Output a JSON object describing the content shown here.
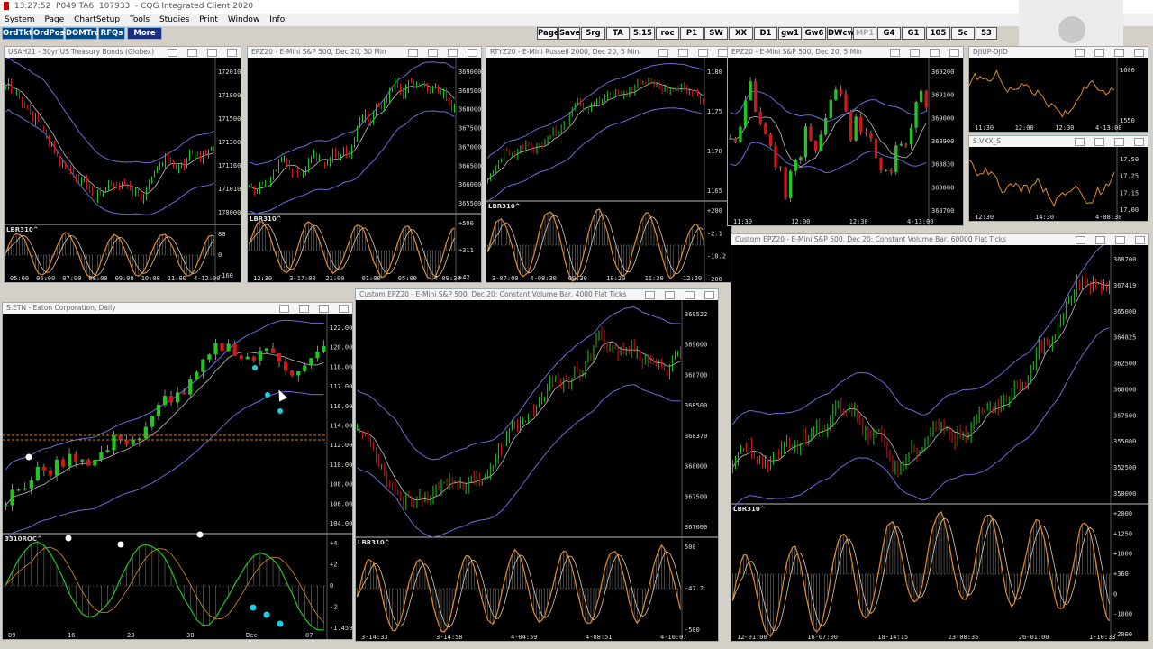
{
  "titlebar": {
    "time": "13:27:52",
    "code1": "P049 TA6",
    "code2": "107933",
    "app": "CQG Integrated Client 2020"
  },
  "menu": [
    "System",
    "Page",
    "ChartSetup",
    "Tools",
    "Studies",
    "Print",
    "Window",
    "Info"
  ],
  "trade_buttons": [
    "OrdTkt",
    "OrdPos",
    "DOMTrd",
    "RFQs",
    "More"
  ],
  "quick_buttons": [
    {
      "label": "Page",
      "dim": false
    },
    {
      "label": "Save",
      "dim": false
    },
    {
      "label": "5rg",
      "dim": false
    },
    {
      "label": "TA",
      "dim": false
    },
    {
      "label": "5.15",
      "dim": false
    },
    {
      "label": "roc",
      "dim": false
    },
    {
      "label": "P1",
      "dim": false
    },
    {
      "label": "SW",
      "dim": false
    },
    {
      "label": "XX",
      "dim": false
    },
    {
      "label": "D1",
      "dim": false
    },
    {
      "label": "gw1",
      "dim": false
    },
    {
      "label": "Gw6",
      "dim": false
    },
    {
      "label": "DWcw",
      "dim": false
    },
    {
      "label": "MP1",
      "dim": true
    },
    {
      "label": "G4",
      "dim": false
    },
    {
      "label": "G1",
      "dim": false
    },
    {
      "label": "105",
      "dim": false
    },
    {
      "label": "5c",
      "dim": false
    },
    {
      "label": "53",
      "dim": false
    }
  ],
  "colors": {
    "up": "#22c522",
    "down": "#d11818",
    "band": "#6b6bd8",
    "ma": "#bfbfbf",
    "osc": "#e08a2a",
    "cyan": "#15d0e8"
  },
  "windows": [
    {
      "id": "usa",
      "title": "USAH21 - 30yr US Treasury Bonds (Globex)",
      "indicator": "LBR310^",
      "price_labels": [
        "172010",
        "171800",
        "171500",
        "171300",
        "171160",
        "171010",
        "170000"
      ],
      "osc_labels": [
        "80",
        "0",
        "-160"
      ],
      "time_labels": [
        "05:00",
        "06:00",
        "07:00",
        "08:00",
        "09:00",
        "10:00",
        "11:00",
        "4-12:00"
      ]
    },
    {
      "id": "ep30",
      "title": "EPZ20 - E-Mini S&P 500, Dec 20, 30 Min",
      "indicator": "LBR310^",
      "price_labels": [
        "369000",
        "368500",
        "368000",
        "367500",
        "367000",
        "366500",
        "366000",
        "365500"
      ],
      "osc_labels": [
        "+500",
        "+311",
        "+42"
      ],
      "time_labels": [
        "12:30",
        "3-17:00",
        "21:00",
        "01:00",
        "05:00",
        "4-09:30"
      ]
    },
    {
      "id": "rtyz",
      "title": "RTYZ20 - E-Mini Russell 2000, Dec 20, 5 Min",
      "indicator": "LBR310^",
      "price_labels": [
        "1180",
        "1175",
        "1170",
        "1165"
      ],
      "osc_labels": [
        "+200",
        "-2.1",
        "-10.2",
        "-200"
      ],
      "time_labels": [
        "3-07:00",
        "4-08:30",
        "09:30",
        "10:20",
        "11:30",
        "12:20"
      ]
    },
    {
      "id": "ep5",
      "title": "EPZ20 - E-Mini S&P 500, Dec 20, 5 Min",
      "price_labels": [
        "369200",
        "369100",
        "369000",
        "368900",
        "368830",
        "368800",
        "368700"
      ],
      "time_labels": [
        "11:30",
        "12:00",
        "12:30",
        "4-13:00"
      ]
    },
    {
      "id": "djup",
      "title": "DJIUP-DJID",
      "price_labels": [
        "1600",
        "1550"
      ],
      "time_labels": [
        "11:30",
        "12:00",
        "12:30",
        "4-13:00"
      ]
    },
    {
      "id": "vxx",
      "title": "S.VXX_S",
      "price_labels": [
        "17.50",
        "17.25",
        "17.15",
        "17.00"
      ],
      "time_labels": [
        "12:30",
        "14:30",
        "4-08:30"
      ]
    },
    {
      "id": "etn",
      "title": "S.ETN - Eaton Corporation, Daily",
      "indicator": "3310ROC^",
      "price_labels": [
        "122.00",
        "120.00",
        "118.00",
        "117.00",
        "116.00",
        "114.00",
        "112.00",
        "110.00",
        "108.00",
        "106.00",
        "104.00"
      ],
      "osc_labels": [
        "+4",
        "+2",
        "0",
        "-2",
        "-1.459"
      ],
      "time_labels": [
        "09",
        "16",
        "23",
        "30",
        "Dec",
        "07"
      ]
    },
    {
      "id": "cvb4000",
      "title": "Custom EPZ20 - E-Mini S&P 500, Dec 20: Constant Volume Bar, 4000 Flat Ticks",
      "indicator": "LBR310^",
      "price_labels": [
        "369522",
        "369000",
        "368700",
        "368500",
        "368370",
        "368000",
        "367500",
        "367000"
      ],
      "osc_labels": [
        "500",
        "-47.2",
        "-500"
      ],
      "time_labels": [
        "3-14:33",
        "3-14:58",
        "4-04:59",
        "4-08:51",
        "4-10:07"
      ]
    },
    {
      "id": "cvb60000",
      "title": "Custom EPZ20 - E-Mini S&P 500, Dec 20: Constant Volume Bar, 60000 Flat Ticks",
      "indicator": "LBR310^",
      "price_labels": [
        "368700",
        "367419",
        "365000",
        "364825",
        "362500",
        "360000",
        "357500",
        "355000",
        "352500",
        "350000"
      ],
      "osc_labels": [
        "+2000",
        "+1250",
        "+1000",
        "+360",
        "0",
        "-1000",
        "-2000"
      ],
      "time_labels": [
        "12-01:00",
        "16-07:00",
        "18-14:15",
        "23-08:35",
        "26-01:00",
        "1-10:33"
      ]
    }
  ]
}
